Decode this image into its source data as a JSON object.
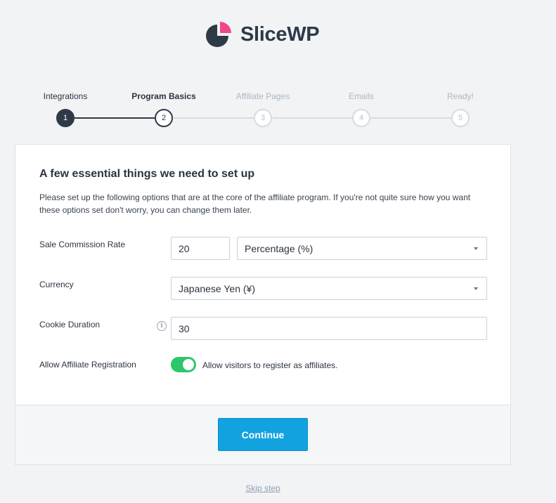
{
  "brand": {
    "name": "SliceWP",
    "accent": "#f0478a",
    "dark": "#2e3a48"
  },
  "steps": [
    {
      "number": "1",
      "label": "Integrations",
      "state": "done"
    },
    {
      "number": "2",
      "label": "Program Basics",
      "state": "current"
    },
    {
      "number": "3",
      "label": "Affiliate Pages",
      "state": "future"
    },
    {
      "number": "4",
      "label": "Emails",
      "state": "future"
    },
    {
      "number": "5",
      "label": "Ready!",
      "state": "future"
    }
  ],
  "form": {
    "title": "A few essential things we need to set up",
    "description": "Please set up the following options that are at the core of the affiliate program. If you're not quite sure how you want these options set don't worry, you can change them later.",
    "commission": {
      "label": "Sale Commission Rate",
      "value": "20",
      "type": "Percentage (%)"
    },
    "currency": {
      "label": "Currency",
      "value": "Japanese Yen (¥)"
    },
    "cookie": {
      "label": "Cookie Duration",
      "value": "30",
      "info_icon": "info-icon"
    },
    "registration": {
      "label": "Allow Affiliate Registration",
      "toggle_on": true,
      "toggle_text": "Allow visitors to register as affiliates."
    }
  },
  "footer": {
    "continue_label": "Continue"
  },
  "skip_label": "Skip step",
  "colors": {
    "toggle_on": "#2dc66b",
    "primary_button": "#12a2e0"
  }
}
